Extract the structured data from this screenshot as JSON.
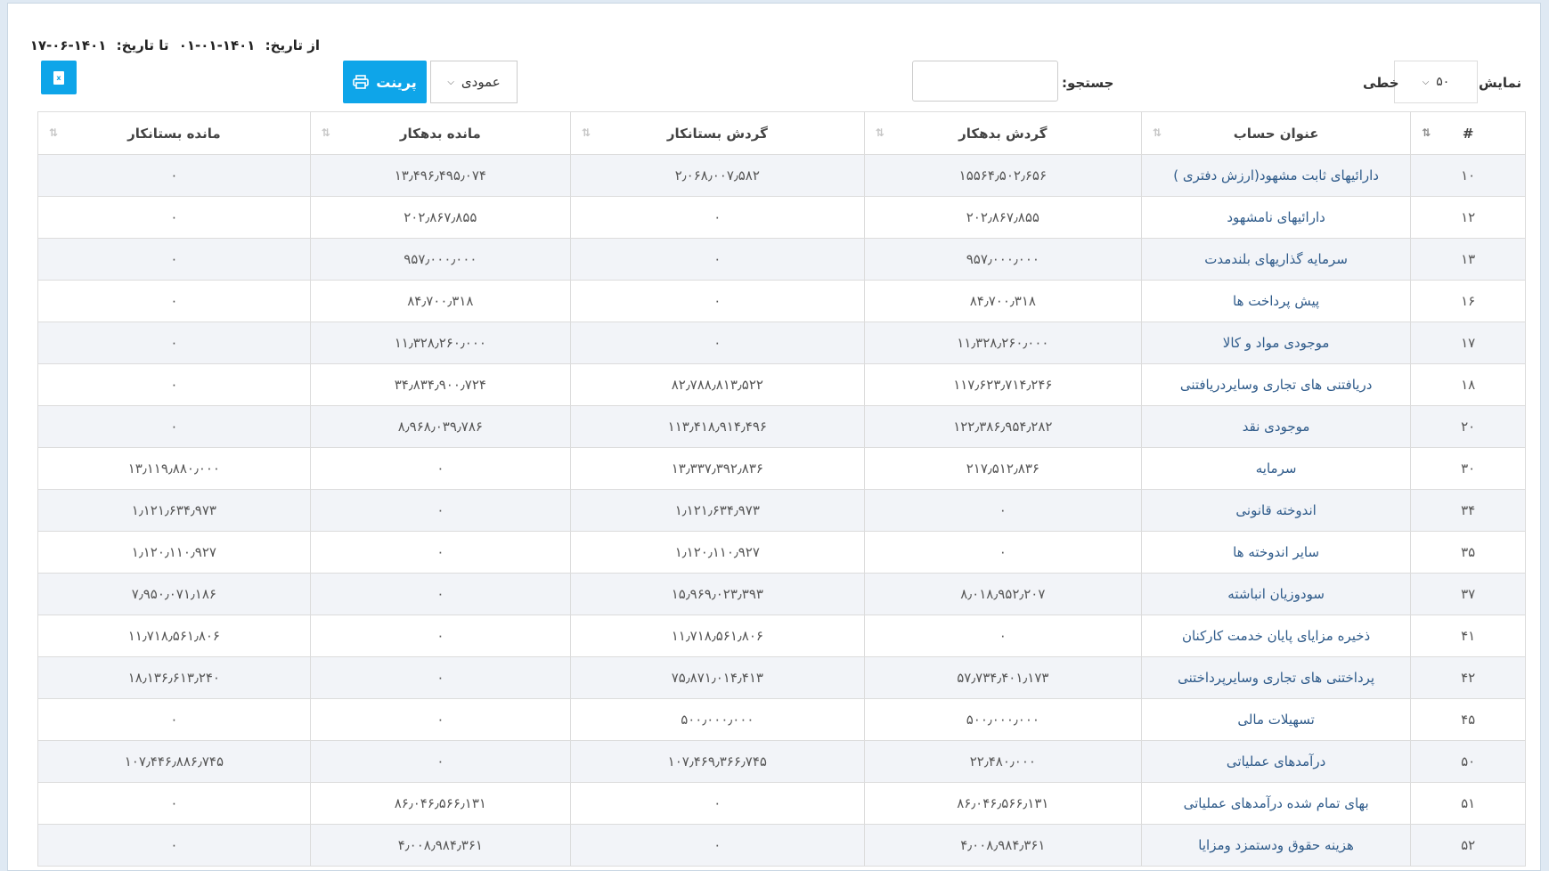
{
  "report": {
    "from_label": "از تاریخ:",
    "from_date": "۱۴۰۱-۰۱-۰۱",
    "to_label": "تا تاریخ:",
    "to_date": "۱۴۰۱-۰۶-۱۷"
  },
  "toolbar": {
    "show_label": "نمایش",
    "page_length": "۵۰",
    "rows_label": "خطی",
    "search_label": "جستجو:",
    "search_value": "",
    "view_mode": "عمودی",
    "print_label": "پرینت",
    "excel_icon_label": "x",
    "accent_color": "#0ea5e9"
  },
  "table": {
    "headers": {
      "index": "#",
      "account_title": "عنوان حساب",
      "debit_turnover": "گردش بدهکار",
      "credit_turnover": "گردش بستانکار",
      "debit_balance": "مانده بدهکار",
      "credit_balance": "مانده بستانکار"
    },
    "rows": [
      {
        "code": "۱۰",
        "title": "دارائیهای ثابت مشهود(ارزش دفتری )",
        "dt": "۱۵۵۶۴٫۵۰۲٫۶۵۶",
        "ct": "۲٫۰۶۸٫۰۰۷٫۵۸۲",
        "db": "۱۳٫۴۹۶٫۴۹۵٫۰۷۴",
        "cb": "۰"
      },
      {
        "code": "۱۲",
        "title": "دارائیهای نامشهود",
        "dt": "۲۰۲٫۸۶۷٫۸۵۵",
        "ct": "۰",
        "db": "۲۰۲٫۸۶۷٫۸۵۵",
        "cb": "۰"
      },
      {
        "code": "۱۳",
        "title": "سرمایه گذاریهای بلندمدت",
        "dt": "۹۵۷٫۰۰۰٫۰۰۰",
        "ct": "۰",
        "db": "۹۵۷٫۰۰۰٫۰۰۰",
        "cb": "۰"
      },
      {
        "code": "۱۶",
        "title": "پیش پرداخت ها",
        "dt": "۸۴٫۷۰۰٫۳۱۸",
        "ct": "۰",
        "db": "۸۴٫۷۰۰٫۳۱۸",
        "cb": "۰"
      },
      {
        "code": "۱۷",
        "title": "موجودی مواد و کالا",
        "dt": "۱۱٫۳۲۸٫۲۶۰٫۰۰۰",
        "ct": "۰",
        "db": "۱۱٫۳۲۸٫۲۶۰٫۰۰۰",
        "cb": "۰"
      },
      {
        "code": "۱۸",
        "title": "دریافتنی های تجاری وسایردریافتنی",
        "dt": "۱۱۷٫۶۲۳٫۷۱۴٫۲۴۶",
        "ct": "۸۲٫۷۸۸٫۸۱۳٫۵۲۲",
        "db": "۳۴٫۸۳۴٫۹۰۰٫۷۲۴",
        "cb": "۰"
      },
      {
        "code": "۲۰",
        "title": "موجودی نقد",
        "dt": "۱۲۲٫۳۸۶٫۹۵۴٫۲۸۲",
        "ct": "۱۱۳٫۴۱۸٫۹۱۴٫۴۹۶",
        "db": "۸٫۹۶۸٫۰۳۹٫۷۸۶",
        "cb": "۰"
      },
      {
        "code": "۳۰",
        "title": "سرمایه",
        "dt": "۲۱۷٫۵۱۲٫۸۳۶",
        "ct": "۱۳٫۳۳۷٫۳۹۲٫۸۳۶",
        "db": "۰",
        "cb": "۱۳٫۱۱۹٫۸۸۰٫۰۰۰"
      },
      {
        "code": "۳۴",
        "title": "اندوخته قانونی",
        "dt": "۰",
        "ct": "۱٫۱۲۱٫۶۳۴٫۹۷۳",
        "db": "۰",
        "cb": "۱٫۱۲۱٫۶۳۴٫۹۷۳"
      },
      {
        "code": "۳۵",
        "title": "سایر اندوخته ها",
        "dt": "۰",
        "ct": "۱٫۱۲۰٫۱۱۰٫۹۲۷",
        "db": "۰",
        "cb": "۱٫۱۲۰٫۱۱۰٫۹۲۷"
      },
      {
        "code": "۳۷",
        "title": "سودوزیان انباشته",
        "dt": "۸٫۰۱۸٫۹۵۲٫۲۰۷",
        "ct": "۱۵٫۹۶۹٫۰۲۳٫۳۹۳",
        "db": "۰",
        "cb": "۷٫۹۵۰٫۰۷۱٫۱۸۶"
      },
      {
        "code": "۴۱",
        "title": "ذخیره مزایای پایان خدمت کارکنان",
        "dt": "۰",
        "ct": "۱۱٫۷۱۸٫۵۶۱٫۸۰۶",
        "db": "۰",
        "cb": "۱۱٫۷۱۸٫۵۶۱٫۸۰۶"
      },
      {
        "code": "۴۲",
        "title": "پرداختنی های تجاری وسایرپرداختنی",
        "dt": "۵۷٫۷۳۴٫۴۰۱٫۱۷۳",
        "ct": "۷۵٫۸۷۱٫۰۱۴٫۴۱۳",
        "db": "۰",
        "cb": "۱۸٫۱۳۶٫۶۱۳٫۲۴۰"
      },
      {
        "code": "۴۵",
        "title": "تسهیلات مالی",
        "dt": "۵۰۰٫۰۰۰٫۰۰۰",
        "ct": "۵۰۰٫۰۰۰٫۰۰۰",
        "db": "۰",
        "cb": "۰"
      },
      {
        "code": "۵۰",
        "title": "درآمدهای عملیاتی",
        "dt": "۲۲٫۴۸۰٫۰۰۰",
        "ct": "۱۰۷٫۴۶۹٫۳۶۶٫۷۴۵",
        "db": "۰",
        "cb": "۱۰۷٫۴۴۶٫۸۸۶٫۷۴۵"
      },
      {
        "code": "۵۱",
        "title": "بهای تمام شده درآمدهای عملیاتی",
        "dt": "۸۶٫۰۴۶٫۵۶۶٫۱۳۱",
        "ct": "۰",
        "db": "۸۶٫۰۴۶٫۵۶۶٫۱۳۱",
        "cb": "۰"
      },
      {
        "code": "۵۲",
        "title": "هزینه حقوق ودستمزد ومزایا",
        "dt": "۴٫۰۰۸٫۹۸۴٫۳۶۱",
        "ct": "۰",
        "db": "۴٫۰۰۸٫۹۸۴٫۳۶۱",
        "cb": "۰"
      }
    ]
  }
}
